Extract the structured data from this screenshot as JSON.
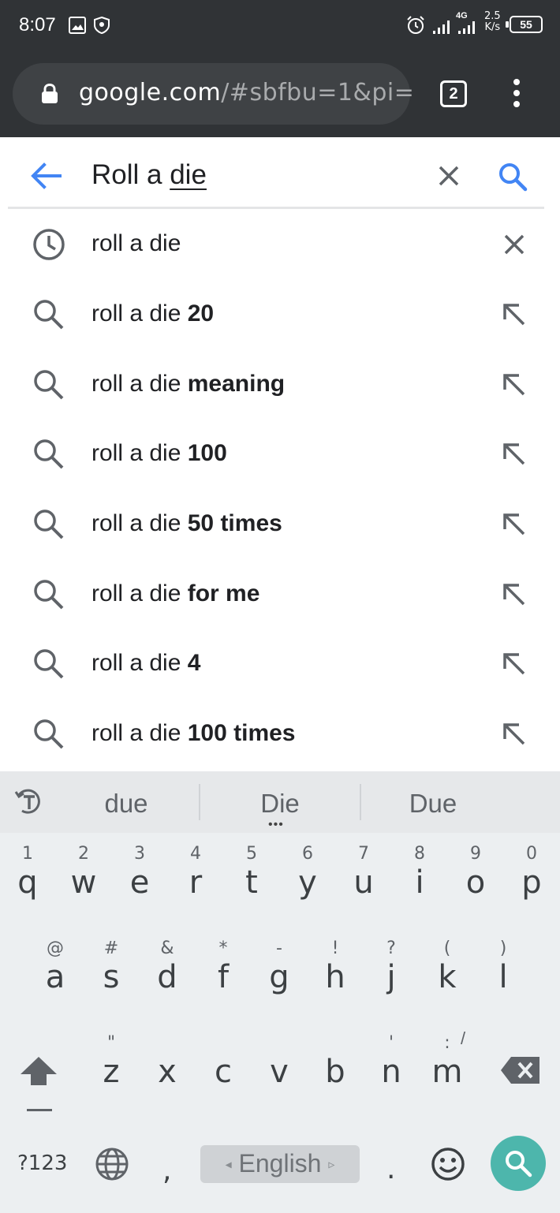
{
  "status_bar": {
    "time": "8:07",
    "net_speed_value": "2.5",
    "net_speed_unit": "K/s",
    "network_label": "4G",
    "battery": "55"
  },
  "toolbar": {
    "url_host": "google.com",
    "url_rest": "/#sbfbu=1&pi=",
    "tab_count": "2"
  },
  "search": {
    "query_prefix": "Roll a ",
    "query_underlined": "die"
  },
  "suggestions": [
    {
      "base": "roll a die",
      "bold": "",
      "icon": "history-icon",
      "action": "remove-icon"
    },
    {
      "base": "roll a die ",
      "bold": "20",
      "icon": "search-icon",
      "action": "fill-arrow-icon"
    },
    {
      "base": "roll a die ",
      "bold": "meaning",
      "icon": "search-icon",
      "action": "fill-arrow-icon"
    },
    {
      "base": "roll a die ",
      "bold": "100",
      "icon": "search-icon",
      "action": "fill-arrow-icon"
    },
    {
      "base": "roll a die ",
      "bold": "50 times",
      "icon": "search-icon",
      "action": "fill-arrow-icon"
    },
    {
      "base": "roll a die ",
      "bold": "for me",
      "icon": "search-icon",
      "action": "fill-arrow-icon"
    },
    {
      "base": "roll a die ",
      "bold": "4",
      "icon": "search-icon",
      "action": "fill-arrow-icon"
    },
    {
      "base": "roll a die ",
      "bold": "100 times",
      "icon": "search-icon",
      "action": "fill-arrow-icon"
    }
  ],
  "keyboard": {
    "word_suggestions": [
      "due",
      "Die",
      "Due"
    ],
    "row1": [
      {
        "hint": "1",
        "key": "q"
      },
      {
        "hint": "2",
        "key": "w"
      },
      {
        "hint": "3",
        "key": "e"
      },
      {
        "hint": "4",
        "key": "r"
      },
      {
        "hint": "5",
        "key": "t"
      },
      {
        "hint": "6",
        "key": "y"
      },
      {
        "hint": "7",
        "key": "u"
      },
      {
        "hint": "8",
        "key": "i"
      },
      {
        "hint": "9",
        "key": "o"
      },
      {
        "hint": "0",
        "key": "p"
      }
    ],
    "row2": [
      {
        "hint": "@",
        "key": "a"
      },
      {
        "hint": "#",
        "key": "s"
      },
      {
        "hint": "&",
        "key": "d"
      },
      {
        "hint": "*",
        "key": "f"
      },
      {
        "hint": "-",
        "key": "g"
      },
      {
        "hint": "!",
        "key": "h"
      },
      {
        "hint": "?",
        "key": "j"
      },
      {
        "hint": "(",
        "key": "k"
      },
      {
        "hint": ")",
        "key": "l"
      }
    ],
    "row3": [
      {
        "hint": "\"",
        "key": "z"
      },
      {
        "hint": "",
        "key": "x"
      },
      {
        "hint": "",
        "key": "c"
      },
      {
        "hint": "",
        "key": "v"
      },
      {
        "hint": "",
        "key": "b"
      },
      {
        "hint": "'",
        "key": "n"
      },
      {
        "hint": ":",
        "key": "m"
      }
    ],
    "row3_m_extra_hint": "/",
    "symbols_label": "?123",
    "comma_label": ",",
    "space_label": "English",
    "period_label": ".",
    "accent_color": "#4db6ac"
  }
}
